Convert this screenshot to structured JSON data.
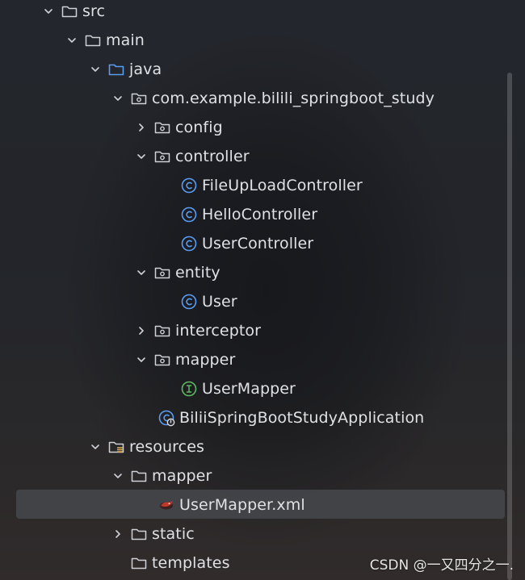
{
  "tree": {
    "items": [
      {
        "label": "src",
        "icon": "folder-icon",
        "state": "expanded"
      },
      {
        "label": "main",
        "icon": "folder-icon",
        "state": "expanded"
      },
      {
        "label": "java",
        "icon": "source-folder-icon",
        "state": "expanded"
      },
      {
        "label": "com.example.bilili_springboot_study",
        "icon": "package-icon",
        "state": "expanded"
      },
      {
        "label": "config",
        "icon": "package-icon",
        "state": "collapsed"
      },
      {
        "label": "controller",
        "icon": "package-icon",
        "state": "expanded"
      },
      {
        "label": "FileUpLoadController",
        "icon": "class-icon"
      },
      {
        "label": "HelloController",
        "icon": "class-icon"
      },
      {
        "label": "UserController",
        "icon": "class-icon"
      },
      {
        "label": "entity",
        "icon": "package-icon",
        "state": "expanded"
      },
      {
        "label": "User",
        "icon": "class-icon"
      },
      {
        "label": "interceptor",
        "icon": "package-icon",
        "state": "collapsed"
      },
      {
        "label": "mapper",
        "icon": "package-icon",
        "state": "expanded"
      },
      {
        "label": "UserMapper",
        "icon": "interface-icon"
      },
      {
        "label": "BiliiSpringBootStudyApplication",
        "icon": "spring-boot-class-icon"
      },
      {
        "label": "resources",
        "icon": "resources-folder-icon",
        "state": "expanded"
      },
      {
        "label": "mapper",
        "icon": "folder-icon",
        "state": "expanded"
      },
      {
        "label": "UserMapper.xml",
        "icon": "mybatis-xml-icon",
        "selected": true
      },
      {
        "label": "static",
        "icon": "folder-icon",
        "state": "collapsed"
      },
      {
        "label": "templates",
        "icon": "folder-icon"
      }
    ]
  },
  "watermark": "CSDN @一又四分之一.",
  "colors": {
    "class_icon": "#5a9cf2",
    "interface_icon": "#5fb865",
    "folder_icon": "#cfd1d6",
    "source_folder_icon": "#5a9cf2",
    "selected_row": "#43454a",
    "text": "#dfe1e5"
  }
}
